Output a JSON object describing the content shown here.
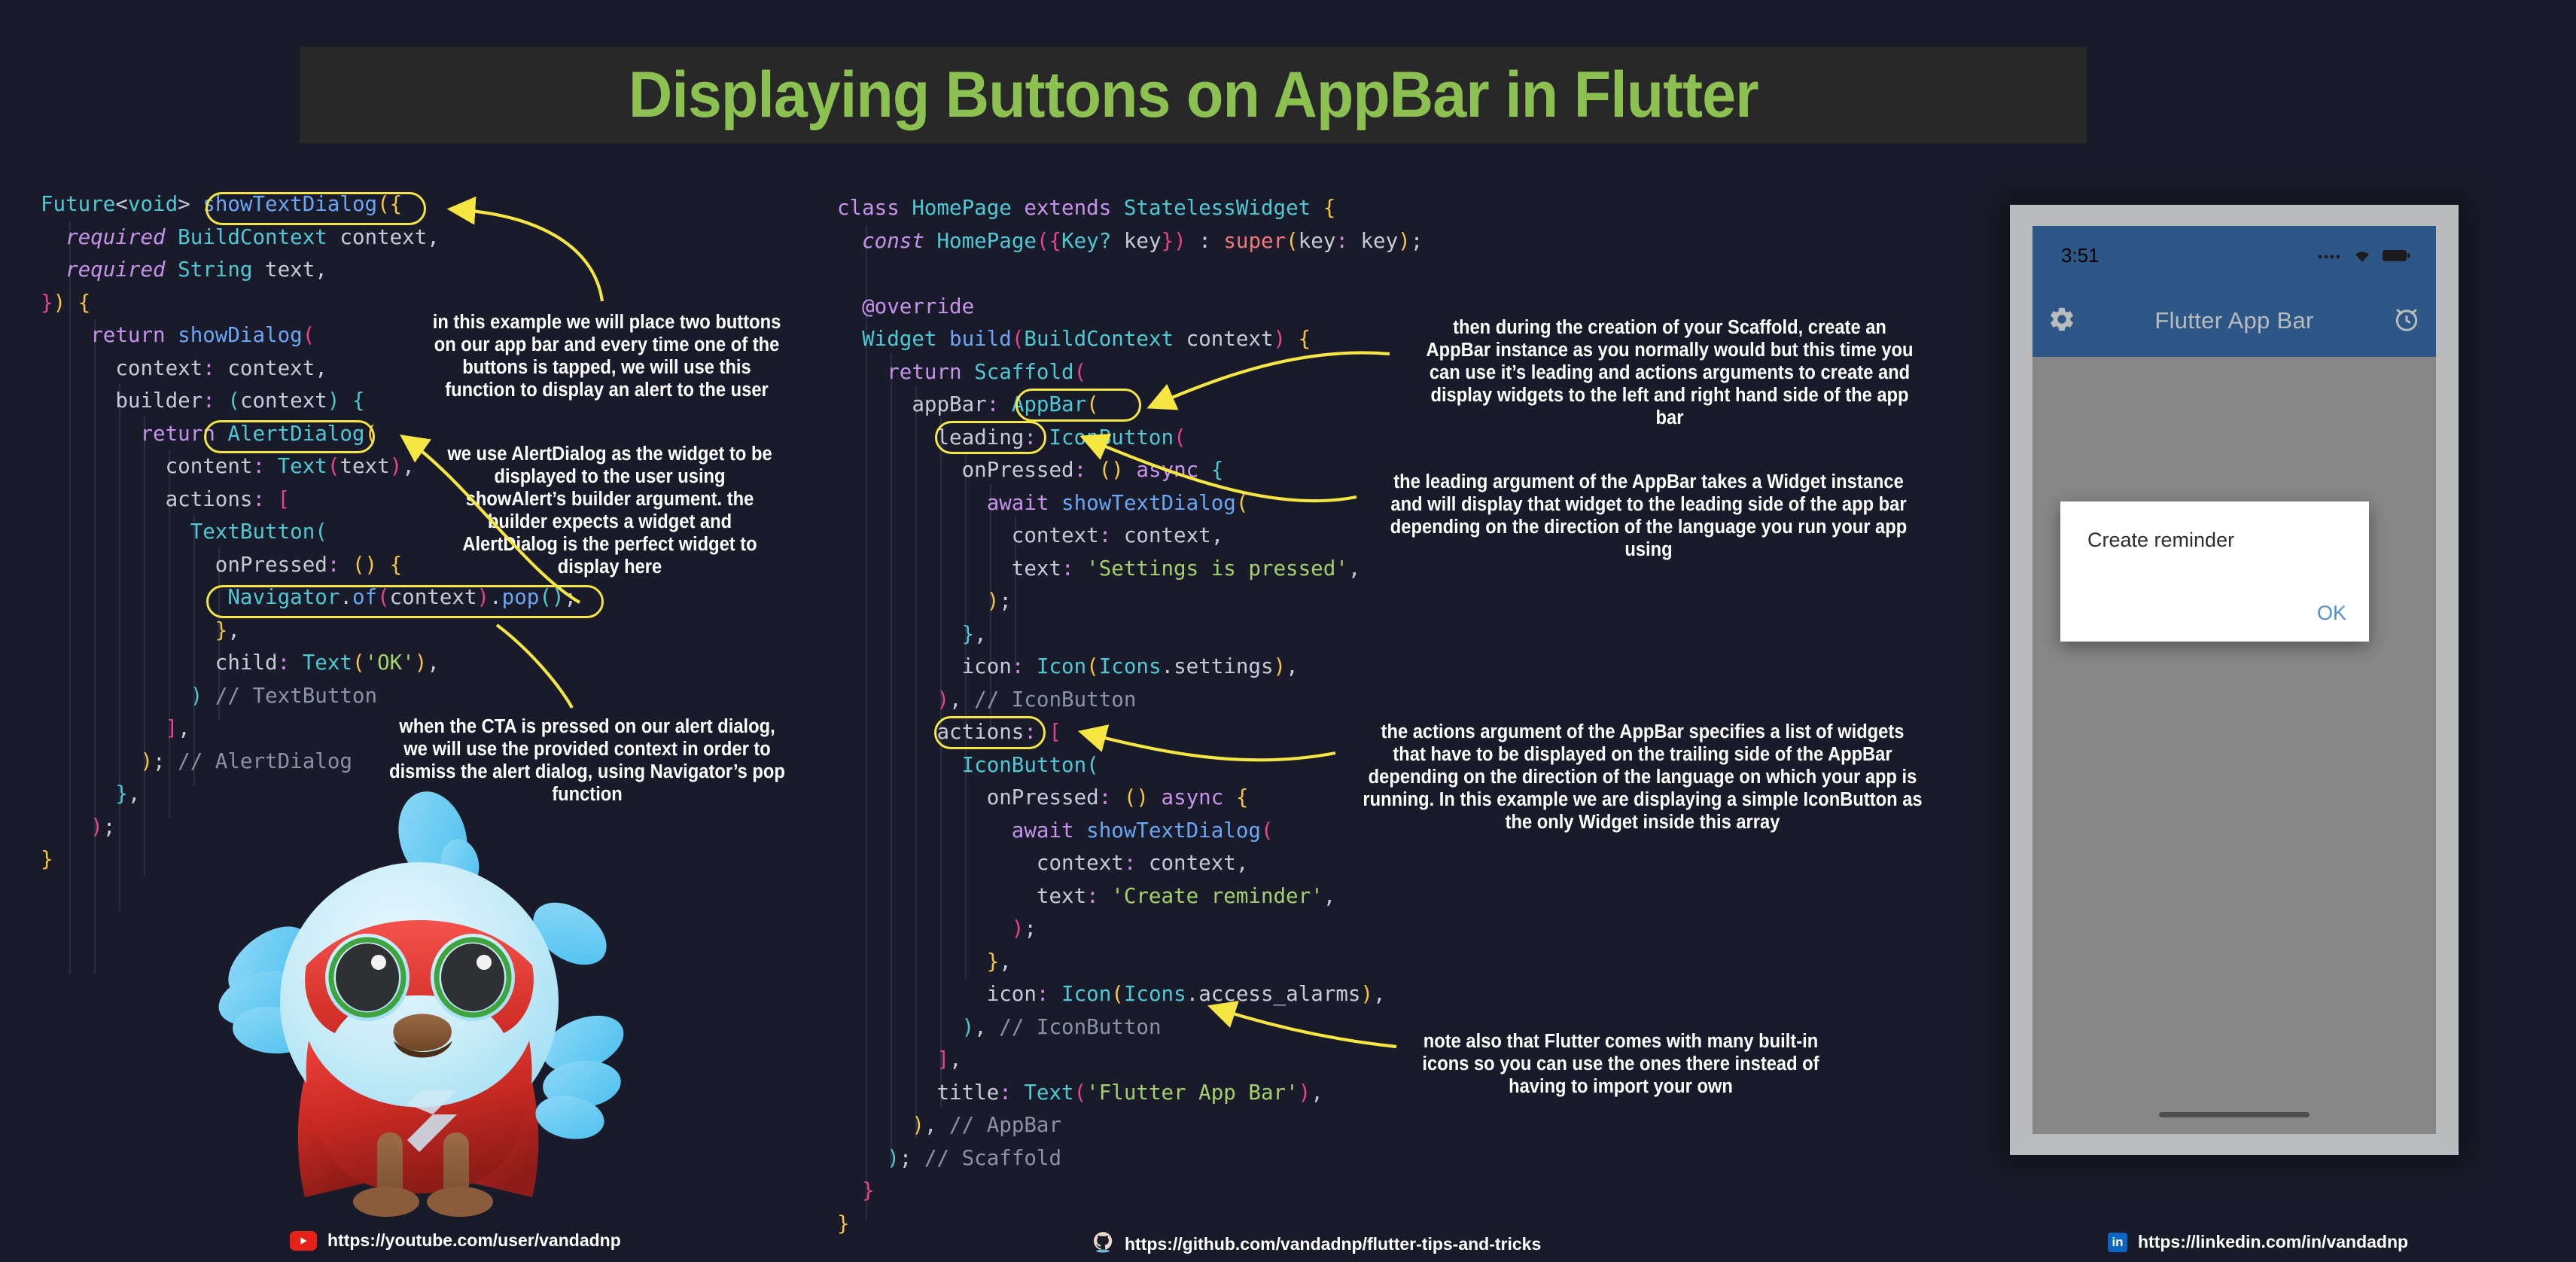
{
  "title": "Displaying Buttons on AppBar in Flutter",
  "theme": {
    "background": "#191b2a",
    "title_banner_bg": "#282828",
    "title_color": "#8cc152",
    "highlight_yellow": "#f5e642",
    "appbar_blue": "#2d5786",
    "dialog_ok_blue": "#4a90e2"
  },
  "code_left": {
    "language": "dart",
    "lines": [
      "Future<void> showTextDialog({",
      "  required BuildContext context,",
      "  required String text,",
      "}) {",
      "  return showDialog(",
      "    context: context,",
      "    builder: (context) {",
      "      return AlertDialog(",
      "        content: Text(text),",
      "        actions: [",
      "          TextButton(",
      "            onPressed: () {",
      "              Navigator.of(context).pop();",
      "            },",
      "            child: Text('OK'),",
      "          ) // TextButton",
      "        ],",
      "      ); // AlertDialog",
      "    },",
      "  );",
      "}"
    ],
    "highlights": [
      "showTextDialog({",
      "AlertDialog(",
      "Navigator.of(context).pop();"
    ]
  },
  "code_mid": {
    "language": "dart",
    "lines": [
      "class HomePage extends StatelessWidget {",
      "  const HomePage({Key? key}) : super(key: key);",
      "",
      "  @override",
      "  Widget build(BuildContext context) {",
      "    return Scaffold(",
      "      appBar: AppBar(",
      "        leading: IconButton(",
      "          onPressed: () async {",
      "            await showTextDialog(",
      "              context: context,",
      "              text: 'Settings is pressed',",
      "            );",
      "          },",
      "          icon: Icon(Icons.settings),",
      "        ), // IconButton",
      "        actions: [",
      "          IconButton(",
      "            onPressed: () async {",
      "              await showTextDialog(",
      "                context: context,",
      "                text: 'Create reminder',",
      "              );",
      "            },",
      "            icon: Icon(Icons.access_alarms),",
      "          ), // IconButton",
      "        ],",
      "        title: Text('Flutter App Bar'),",
      "      ), // AppBar",
      "    ); // Scaffold",
      "  }",
      "}"
    ],
    "highlights": [
      "AppBar(",
      "leading:",
      "actions:"
    ]
  },
  "annotations": [
    {
      "id": "note-show-text-dialog",
      "text": "in this example we will place two buttons on our app bar and every time one of the buttons is tapped, we will use this function to display an alert to the user"
    },
    {
      "id": "note-alert-dialog",
      "text": "we use AlertDialog as the widget to be displayed to the user using showAlert’s builder argument. the builder expects a widget and AlertDialog is the perfect widget to display here"
    },
    {
      "id": "note-navigator-pop",
      "text": "when the CTA is pressed on our alert dialog, we will use the provided context in order to dismiss the alert dialog, using Navigator’s pop function"
    },
    {
      "id": "note-appbar",
      "text": "then during the creation of your Scaffold, create an AppBar instance as you normally would but this time you can use it’s leading and actions arguments to create and display widgets to the left and right hand side of the app bar"
    },
    {
      "id": "note-leading",
      "text": "the leading argument of the AppBar takes a Widget instance and will display that widget to the leading side of the app bar depending on the direction of the language you run your app using"
    },
    {
      "id": "note-actions",
      "text": "the actions argument of the AppBar specifies a list of widgets that have to be displayed on the trailing side of the AppBar depending on the direction of the language on which your app is running. In this example we are displaying a simple IconButton as the only Widget inside this array"
    },
    {
      "id": "note-icons",
      "text": "note also that Flutter comes with many built-in icons so you can use the ones there instead of having to import your own"
    }
  ],
  "phone": {
    "status_time": "3:51",
    "status_icons": [
      "signal-dots-icon",
      "wifi-icon",
      "battery-icon"
    ],
    "appbar": {
      "leading_icon": "gear-icon",
      "title": "Flutter App Bar",
      "action_icon": "alarm-clock-icon"
    },
    "dialog": {
      "message": "Create reminder",
      "ok_label": "OK"
    }
  },
  "footer": {
    "youtube": {
      "icon": "youtube-icon",
      "url": "https://youtube.com/user/vandadnp"
    },
    "github": {
      "icon": "github-icon",
      "url": "https://github.com/vandadnp/flutter-tips-and-tricks"
    },
    "linkedin": {
      "icon": "linkedin-icon",
      "badge": "in",
      "url": "https://linkedin.com/in/vandadnp"
    }
  },
  "mascot": {
    "name": "flutter-dash-superhero-mascot"
  }
}
